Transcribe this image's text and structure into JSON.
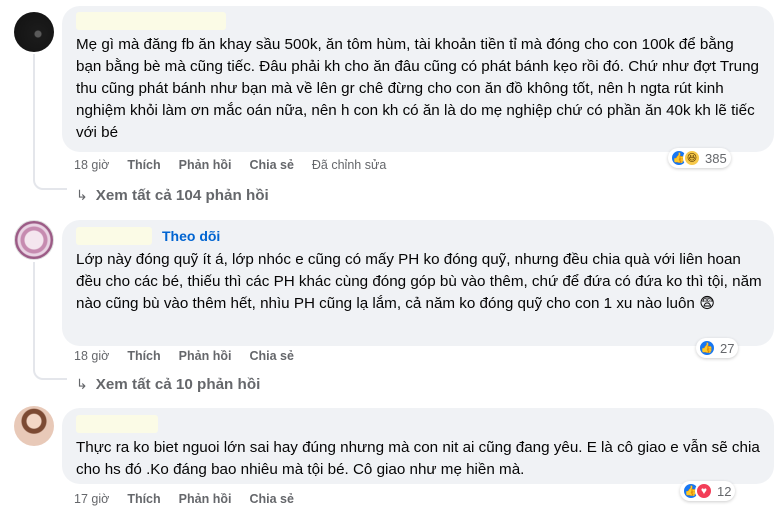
{
  "comments": [
    {
      "name": "",
      "text": "Mẹ gì mà đăng fb ăn khay sầu 500k, ăn tôm hùm, tài khoản tiền tỉ mà đóng cho con 100k để bằng bạn bằng bè mà cũng tiếc. Đâu phải kh cho ăn đâu cũng có phát bánh kẹo rồi đó. Chứ như đợt Trung thu cũng phát bánh như bạn mà về lên gr chê đừng cho con ăn đồ không tốt, nên h ngta rút kinh nghiệm khỏi làm ơn mắc oán nữa, nên h con kh có ăn là do mẹ nghiệp chứ có phần ăn 40k kh lẽ tiếc với bé",
      "time": "18 giờ",
      "like": "Thích",
      "reply": "Phản hồi",
      "share": "Chia sẻ",
      "edited": "Đã chỉnh sửa",
      "reaction_count": "385",
      "view_replies": "Xem tất cả 104 phản hồi"
    },
    {
      "name": "",
      "follow": "Theo dõi",
      "text": "Lớp này đóng quỹ ít á, lớp nhóc e cũng có mấy PH ko đóng quỹ, nhưng đều chia quà với liên hoan đều cho các bé, thiếu thì các PH khác cùng đóng góp bù vào thêm, chứ để đứa có đứa ko thì tội, năm nào cũng bù vào thêm hết, nhìu PH cũng lạ lắm, cả năm ko đóng quỹ cho con 1 xu nào luôn 😨",
      "time": "18 giờ",
      "like": "Thích",
      "reply": "Phản hồi",
      "share": "Chia sẻ",
      "reaction_count": "27",
      "view_replies": "Xem tất cả 10 phản hồi"
    },
    {
      "name": "",
      "text": "Thực ra ko biet nguoi lớn sai hay đúng nhưng mà con nit ai cũng đang yêu. E là cô giao e vẫn sẽ chia cho hs đó .Ko đáng bao nhiêu mà tội bé. Cô giao như mẹ hiền mà.",
      "time": "17 giờ",
      "like": "Thích",
      "reply": "Phản hồi",
      "share": "Chia sẻ",
      "reaction_count": "12"
    }
  ],
  "icons": {
    "like": "thumbs-up-icon",
    "haha": "haha-icon",
    "love": "heart-icon",
    "arrow": "reply-arrow-icon"
  },
  "colors": {
    "bubble": "#f0f2f5",
    "meta": "#65676b",
    "follow": "#0064d1",
    "like": "#1877f2",
    "love": "#f33e58"
  }
}
